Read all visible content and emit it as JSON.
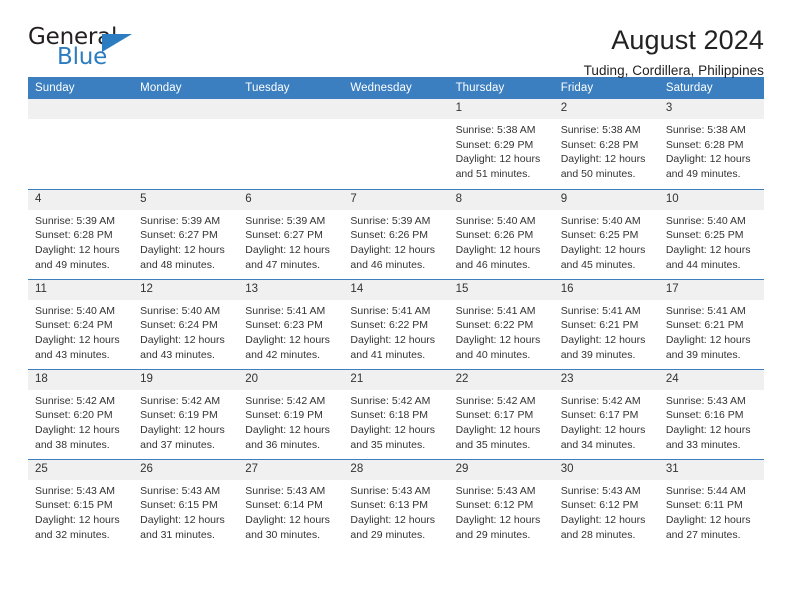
{
  "brand": {
    "name_part1": "General",
    "name_part2": "Blue",
    "accent_color": "#2b7cc0"
  },
  "header": {
    "title": "August 2024",
    "subtitle": "Tuding, Cordillera, Philippines"
  },
  "calendar": {
    "header_bg": "#3b7fc0",
    "daynum_bg": "#f0f0f0",
    "weekday_headers": [
      "Sunday",
      "Monday",
      "Tuesday",
      "Wednesday",
      "Thursday",
      "Friday",
      "Saturday"
    ],
    "weeks": [
      [
        {
          "empty": true
        },
        {
          "empty": true
        },
        {
          "empty": true
        },
        {
          "empty": true
        },
        {
          "day": "1",
          "sunrise": "Sunrise: 5:38 AM",
          "sunset": "Sunset: 6:29 PM",
          "daylight": "Daylight: 12 hours and 51 minutes."
        },
        {
          "day": "2",
          "sunrise": "Sunrise: 5:38 AM",
          "sunset": "Sunset: 6:28 PM",
          "daylight": "Daylight: 12 hours and 50 minutes."
        },
        {
          "day": "3",
          "sunrise": "Sunrise: 5:38 AM",
          "sunset": "Sunset: 6:28 PM",
          "daylight": "Daylight: 12 hours and 49 minutes."
        }
      ],
      [
        {
          "day": "4",
          "sunrise": "Sunrise: 5:39 AM",
          "sunset": "Sunset: 6:28 PM",
          "daylight": "Daylight: 12 hours and 49 minutes."
        },
        {
          "day": "5",
          "sunrise": "Sunrise: 5:39 AM",
          "sunset": "Sunset: 6:27 PM",
          "daylight": "Daylight: 12 hours and 48 minutes."
        },
        {
          "day": "6",
          "sunrise": "Sunrise: 5:39 AM",
          "sunset": "Sunset: 6:27 PM",
          "daylight": "Daylight: 12 hours and 47 minutes."
        },
        {
          "day": "7",
          "sunrise": "Sunrise: 5:39 AM",
          "sunset": "Sunset: 6:26 PM",
          "daylight": "Daylight: 12 hours and 46 minutes."
        },
        {
          "day": "8",
          "sunrise": "Sunrise: 5:40 AM",
          "sunset": "Sunset: 6:26 PM",
          "daylight": "Daylight: 12 hours and 46 minutes."
        },
        {
          "day": "9",
          "sunrise": "Sunrise: 5:40 AM",
          "sunset": "Sunset: 6:25 PM",
          "daylight": "Daylight: 12 hours and 45 minutes."
        },
        {
          "day": "10",
          "sunrise": "Sunrise: 5:40 AM",
          "sunset": "Sunset: 6:25 PM",
          "daylight": "Daylight: 12 hours and 44 minutes."
        }
      ],
      [
        {
          "day": "11",
          "sunrise": "Sunrise: 5:40 AM",
          "sunset": "Sunset: 6:24 PM",
          "daylight": "Daylight: 12 hours and 43 minutes."
        },
        {
          "day": "12",
          "sunrise": "Sunrise: 5:40 AM",
          "sunset": "Sunset: 6:24 PM",
          "daylight": "Daylight: 12 hours and 43 minutes."
        },
        {
          "day": "13",
          "sunrise": "Sunrise: 5:41 AM",
          "sunset": "Sunset: 6:23 PM",
          "daylight": "Daylight: 12 hours and 42 minutes."
        },
        {
          "day": "14",
          "sunrise": "Sunrise: 5:41 AM",
          "sunset": "Sunset: 6:22 PM",
          "daylight": "Daylight: 12 hours and 41 minutes."
        },
        {
          "day": "15",
          "sunrise": "Sunrise: 5:41 AM",
          "sunset": "Sunset: 6:22 PM",
          "daylight": "Daylight: 12 hours and 40 minutes."
        },
        {
          "day": "16",
          "sunrise": "Sunrise: 5:41 AM",
          "sunset": "Sunset: 6:21 PM",
          "daylight": "Daylight: 12 hours and 39 minutes."
        },
        {
          "day": "17",
          "sunrise": "Sunrise: 5:41 AM",
          "sunset": "Sunset: 6:21 PM",
          "daylight": "Daylight: 12 hours and 39 minutes."
        }
      ],
      [
        {
          "day": "18",
          "sunrise": "Sunrise: 5:42 AM",
          "sunset": "Sunset: 6:20 PM",
          "daylight": "Daylight: 12 hours and 38 minutes."
        },
        {
          "day": "19",
          "sunrise": "Sunrise: 5:42 AM",
          "sunset": "Sunset: 6:19 PM",
          "daylight": "Daylight: 12 hours and 37 minutes."
        },
        {
          "day": "20",
          "sunrise": "Sunrise: 5:42 AM",
          "sunset": "Sunset: 6:19 PM",
          "daylight": "Daylight: 12 hours and 36 minutes."
        },
        {
          "day": "21",
          "sunrise": "Sunrise: 5:42 AM",
          "sunset": "Sunset: 6:18 PM",
          "daylight": "Daylight: 12 hours and 35 minutes."
        },
        {
          "day": "22",
          "sunrise": "Sunrise: 5:42 AM",
          "sunset": "Sunset: 6:17 PM",
          "daylight": "Daylight: 12 hours and 35 minutes."
        },
        {
          "day": "23",
          "sunrise": "Sunrise: 5:42 AM",
          "sunset": "Sunset: 6:17 PM",
          "daylight": "Daylight: 12 hours and 34 minutes."
        },
        {
          "day": "24",
          "sunrise": "Sunrise: 5:43 AM",
          "sunset": "Sunset: 6:16 PM",
          "daylight": "Daylight: 12 hours and 33 minutes."
        }
      ],
      [
        {
          "day": "25",
          "sunrise": "Sunrise: 5:43 AM",
          "sunset": "Sunset: 6:15 PM",
          "daylight": "Daylight: 12 hours and 32 minutes."
        },
        {
          "day": "26",
          "sunrise": "Sunrise: 5:43 AM",
          "sunset": "Sunset: 6:15 PM",
          "daylight": "Daylight: 12 hours and 31 minutes."
        },
        {
          "day": "27",
          "sunrise": "Sunrise: 5:43 AM",
          "sunset": "Sunset: 6:14 PM",
          "daylight": "Daylight: 12 hours and 30 minutes."
        },
        {
          "day": "28",
          "sunrise": "Sunrise: 5:43 AM",
          "sunset": "Sunset: 6:13 PM",
          "daylight": "Daylight: 12 hours and 29 minutes."
        },
        {
          "day": "29",
          "sunrise": "Sunrise: 5:43 AM",
          "sunset": "Sunset: 6:12 PM",
          "daylight": "Daylight: 12 hours and 29 minutes."
        },
        {
          "day": "30",
          "sunrise": "Sunrise: 5:43 AM",
          "sunset": "Sunset: 6:12 PM",
          "daylight": "Daylight: 12 hours and 28 minutes."
        },
        {
          "day": "31",
          "sunrise": "Sunrise: 5:44 AM",
          "sunset": "Sunset: 6:11 PM",
          "daylight": "Daylight: 12 hours and 27 minutes."
        }
      ]
    ]
  }
}
